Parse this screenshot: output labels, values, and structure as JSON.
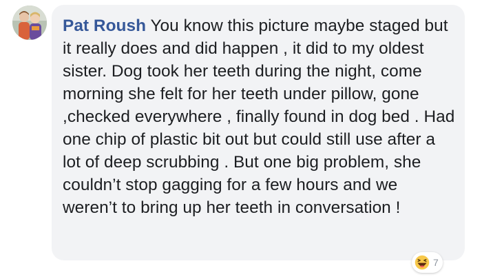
{
  "comment": {
    "author": "Pat Roush",
    "text": "You know this picture maybe staged but it really does and did happen , it did to my oldest sister. Dog took her teeth during the night, come morning she felt for her teeth under pillow, gone ,checked everywhere , finally found in dog bed . Had one chip of plastic bit out but could still use after a lot of deep scrubbing . But one big problem, she couldn’t stop gagging for a few hours and we weren’t to bring up her teeth in conversation !"
  },
  "reactions": {
    "icon": "haha-icon",
    "count": "7"
  },
  "colors": {
    "bubble": "#f2f3f5",
    "author": "#365899",
    "text": "#1c1e21",
    "count": "#8d949e"
  }
}
